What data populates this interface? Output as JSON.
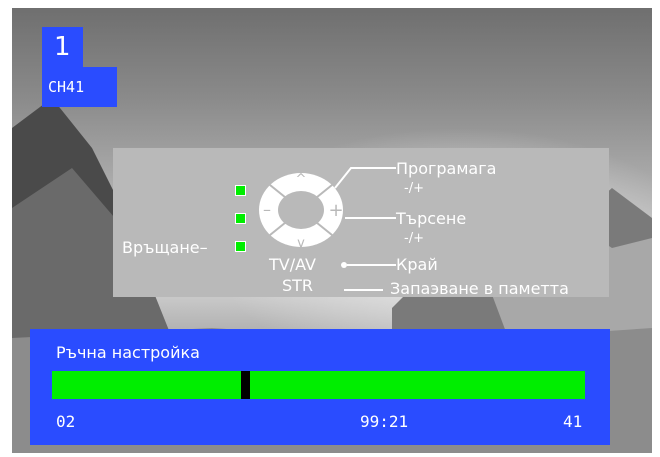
{
  "channel": {
    "number": "1",
    "label": "CH41"
  },
  "help": {
    "program": "Програмага",
    "program_pm": "-/+",
    "search": "Търсене",
    "search_pm": "-/+",
    "exit": "Край",
    "store": "Запаэване в паметта",
    "back": "Връщане",
    "back_dash": "–",
    "tvav": "TV/AV",
    "str": "STR",
    "pad_minus": "–",
    "pad_plus": "+",
    "pad_up": "^",
    "pad_down": "v"
  },
  "tuning": {
    "title": "Ръчна настройка",
    "left_value": "02",
    "center_value": "99:21",
    "right_value": "41",
    "progress_fraction": 0.36
  },
  "colors": {
    "osd_blue": "#2a4cff",
    "bar_green": "#00ee00",
    "panel_gray": "#b9b9b9"
  }
}
